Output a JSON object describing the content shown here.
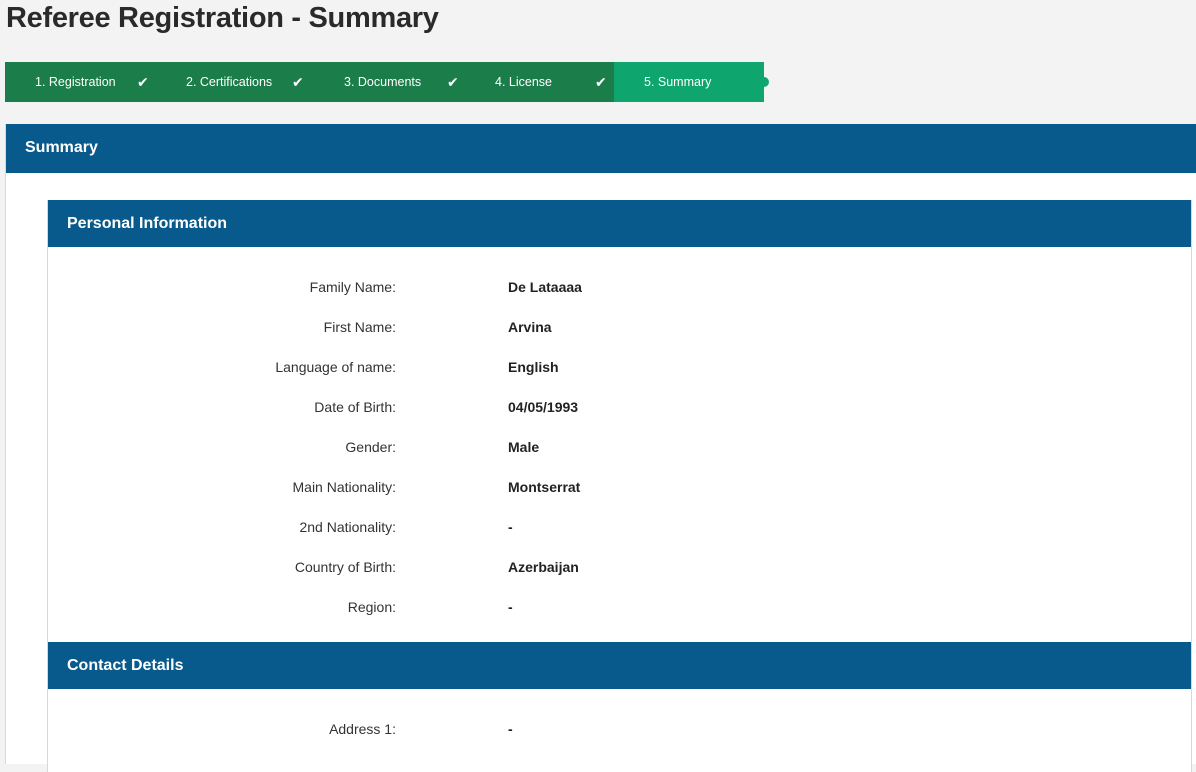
{
  "page": {
    "title": "Referee Registration - Summary"
  },
  "stepper": {
    "steps": [
      {
        "label": "1. Registration",
        "status": "done"
      },
      {
        "label": "2. Certifications",
        "status": "done"
      },
      {
        "label": "3. Documents",
        "status": "done"
      },
      {
        "label": "4. License",
        "status": "done"
      },
      {
        "label": "5. Summary",
        "status": "active"
      }
    ],
    "check_glyph": "✔"
  },
  "summary": {
    "title": "Summary"
  },
  "personal": {
    "title": "Personal Information",
    "fields": [
      {
        "label": "Family Name:",
        "value": "De Lataaaa"
      },
      {
        "label": "First Name:",
        "value": "Arvina"
      },
      {
        "label": "Language of name:",
        "value": "English"
      },
      {
        "label": "Date of Birth:",
        "value": "04/05/1993"
      },
      {
        "label": "Gender:",
        "value": "Male"
      },
      {
        "label": "Main Nationality:",
        "value": "Montserrat"
      },
      {
        "label": "2nd Nationality:",
        "value": "-"
      },
      {
        "label": "Country of Birth:",
        "value": "Azerbaijan"
      },
      {
        "label": "Region:",
        "value": "-"
      }
    ]
  },
  "contact": {
    "title": "Contact Details",
    "fields": [
      {
        "label": "Address 1:",
        "value": "-"
      }
    ]
  },
  "colors": {
    "step_done": "#1b7d4a",
    "step_active": "#0fa56e",
    "header_blue": "#095a8c"
  }
}
